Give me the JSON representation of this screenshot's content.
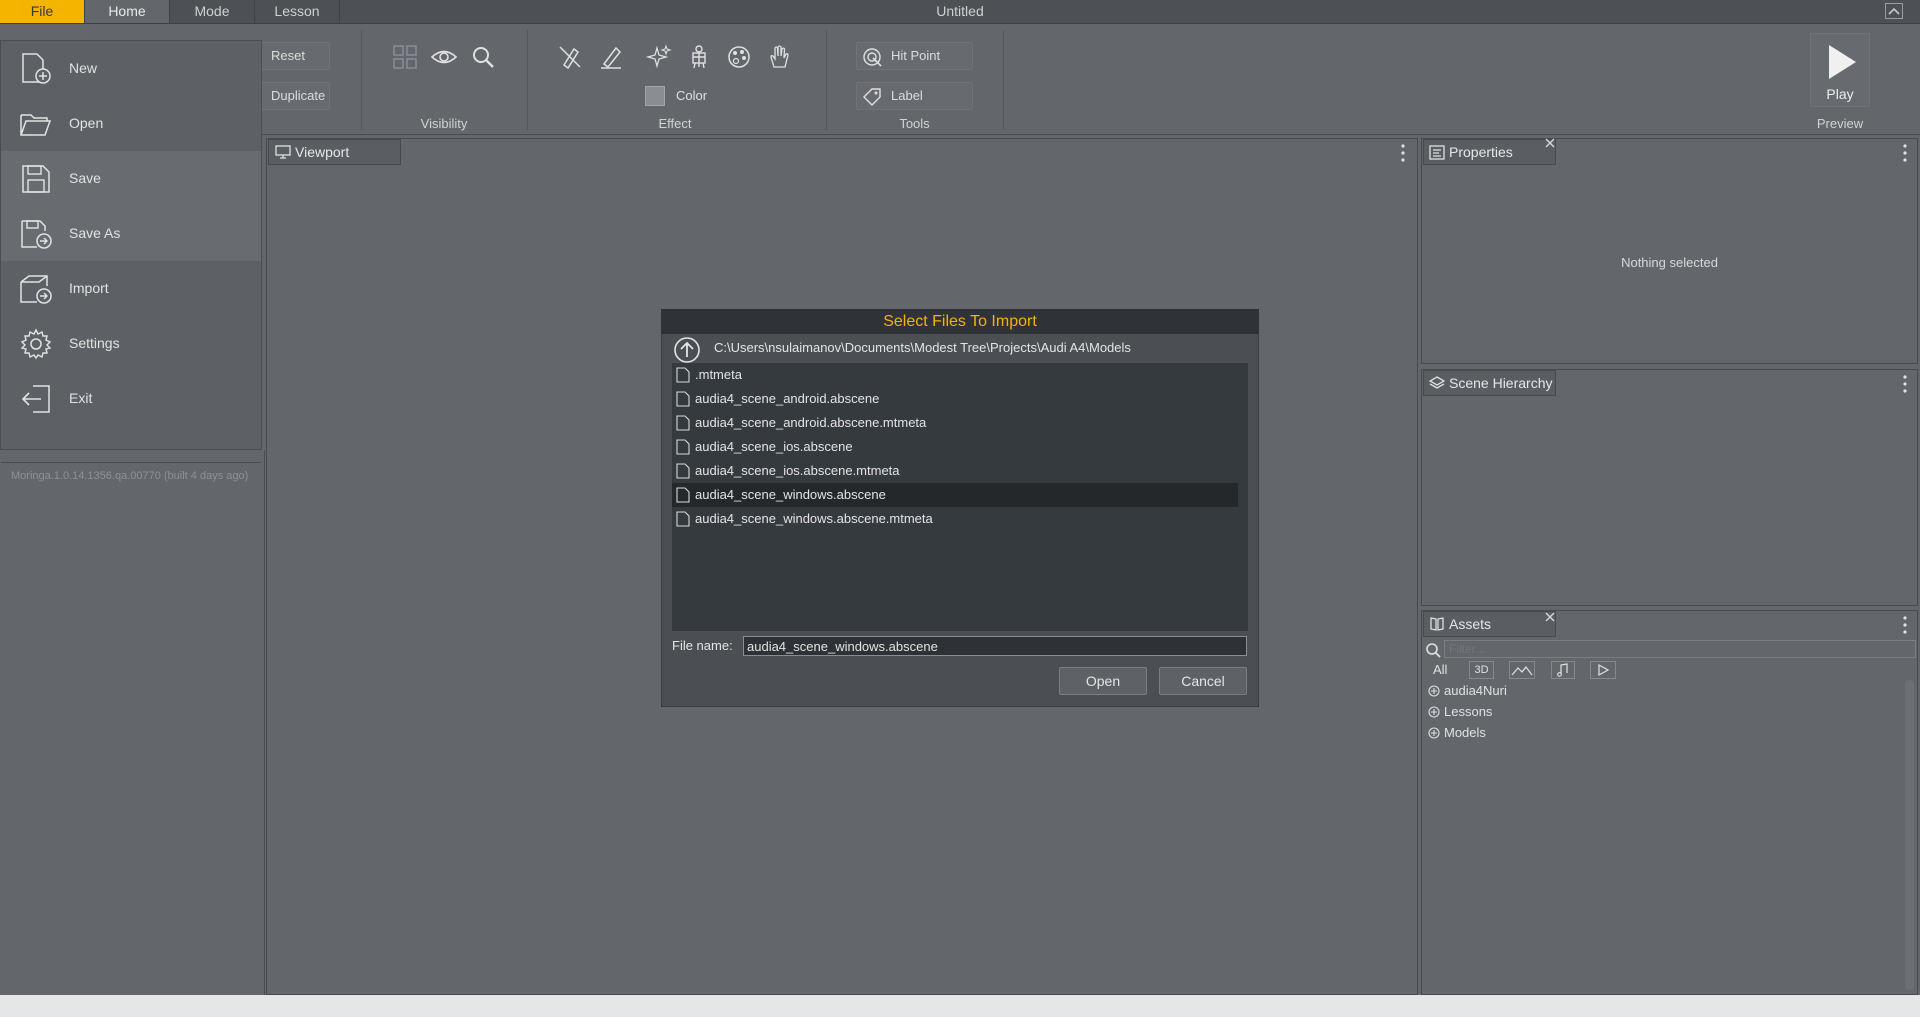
{
  "window": {
    "title": "Untitled"
  },
  "tabs": [
    {
      "label": "File"
    },
    {
      "label": "Home"
    },
    {
      "label": "Mode"
    },
    {
      "label": "Lesson"
    }
  ],
  "ribbon": {
    "reset_label": "Reset",
    "duplicate_label": "Duplicate",
    "visibility_label": "Visibility",
    "effect_label": "Effect",
    "color_label": "Color",
    "tools_label": "Tools",
    "hit_point_label": "Hit Point",
    "label_label": "Label",
    "play_label": "Play",
    "preview_label": "Preview"
  },
  "file_menu": {
    "items": [
      {
        "label": "New",
        "icon": "new-file-icon"
      },
      {
        "label": "Open",
        "icon": "folder-icon"
      },
      {
        "label": "Save",
        "icon": "save-icon"
      },
      {
        "label": "Save As",
        "icon": "save-as-icon"
      },
      {
        "label": "Import",
        "icon": "import-icon"
      },
      {
        "label": "Settings",
        "icon": "gear-icon"
      },
      {
        "label": "Exit",
        "icon": "exit-icon"
      }
    ],
    "version": "Moringa.1.0.14.1356.qa.00770 (built 4 days ago)"
  },
  "viewport": {
    "tab_label": "Viewport"
  },
  "properties": {
    "tab_label": "Properties",
    "empty_text": "Nothing selected"
  },
  "scene_hierarchy": {
    "tab_label": "Scene Hierarchy"
  },
  "assets": {
    "tab_label": "Assets",
    "filter_placeholder": "Filter...",
    "filter_all": "All",
    "filter_3d": "3D",
    "tree": [
      {
        "label": "audia4Nuri"
      },
      {
        "label": "Lessons"
      },
      {
        "label": "Models"
      }
    ]
  },
  "dialog": {
    "title": "Select Files To Import",
    "path": "C:\\Users\\nsulaimanov\\Documents\\Modest Tree\\Projects\\Audi A4\\Models",
    "files": [
      {
        "name": ".mtmeta"
      },
      {
        "name": "audia4_scene_android.abscene"
      },
      {
        "name": "audia4_scene_android.abscene.mtmeta"
      },
      {
        "name": "audia4_scene_ios.abscene"
      },
      {
        "name": "audia4_scene_ios.abscene.mtmeta"
      },
      {
        "name": "audia4_scene_windows.abscene"
      },
      {
        "name": "audia4_scene_windows.abscene.mtmeta"
      }
    ],
    "selected_index": 5,
    "file_name_label": "File name:",
    "file_name_value": "audia4_scene_windows.abscene",
    "open_label": "Open",
    "cancel_label": "Cancel"
  },
  "colors": {
    "accent": "#f4b400",
    "panel": "#63676c",
    "dark": "#353a3f"
  }
}
